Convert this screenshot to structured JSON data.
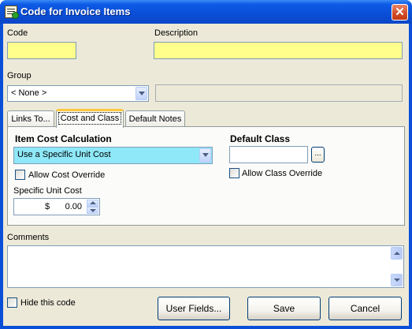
{
  "window": {
    "title": "Code for Invoice Items",
    "close_glyph": "✕"
  },
  "fields": {
    "code": {
      "label": "Code",
      "value": ""
    },
    "description": {
      "label": "Description",
      "value": ""
    },
    "group": {
      "label": "Group",
      "selected": "< None >",
      "extra_value": ""
    }
  },
  "tabs": [
    {
      "label": "Links To...",
      "active": false
    },
    {
      "label": "Cost and Class",
      "active": true
    },
    {
      "label": "Default Notes",
      "active": false
    }
  ],
  "cost_tab": {
    "item_cost_heading": "Item Cost Calculation",
    "cost_method": "Use a Specific Unit Cost",
    "allow_cost_override": {
      "label": "Allow Cost Override",
      "checked": false
    },
    "specific_unit_cost": {
      "label": "Specific Unit Cost",
      "currency": "$",
      "value": "0.00"
    },
    "default_class_heading": "Default Class",
    "default_class_value": "",
    "browse_label": "...",
    "allow_class_override": {
      "label": "Allow Class Override",
      "checked": false
    }
  },
  "comments": {
    "label": "Comments",
    "value": ""
  },
  "footer": {
    "hide_code": {
      "label": "Hide this code",
      "checked": false
    },
    "user_fields_button": "User Fields...",
    "save_button": "Save",
    "cancel_button": "Cancel"
  },
  "colors": {
    "titlebar": "#0a4fd8",
    "required_field": "#ffff8c",
    "selected_combo": "#8ee8f8",
    "active_tab_accent": "#ffc83c",
    "dialog_face": "#ece9d8"
  }
}
